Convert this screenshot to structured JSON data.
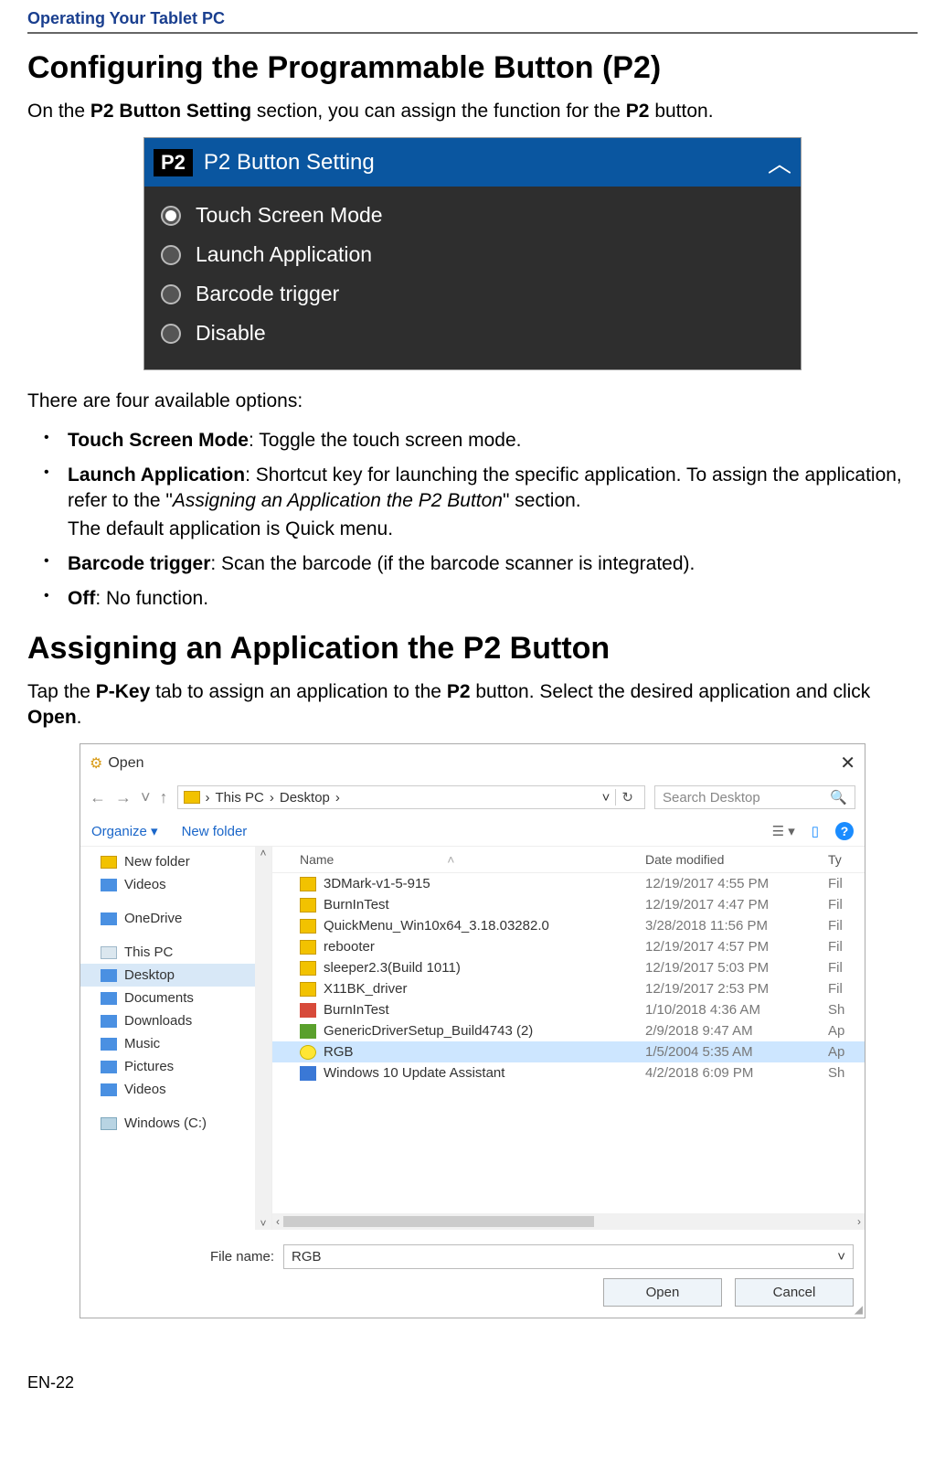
{
  "header": "Operating Your Tablet PC",
  "h1": "Configuring the Programmable Button (P2)",
  "p1_a": "On the ",
  "p1_b": "P2 Button Setting",
  "p1_c": " section, you can assign the function for the ",
  "p1_d": "P2",
  "p1_e": " button.",
  "panel": {
    "badge": "P2",
    "title": "P2 Button Setting",
    "options": [
      "Touch Screen Mode",
      "Launch Application",
      "Barcode trigger",
      "Disable"
    ],
    "selected": 0
  },
  "intro_list": "There are four available options:",
  "opts": {
    "o1_b": "Touch Screen Mode",
    "o1_t": ": Toggle the touch screen mode.",
    "o2_b": "Launch Application",
    "o2_t1": ": Shortcut key for launching the specific application. To assign the application, refer to the \"",
    "o2_i": "Assigning an Application the P2 Button",
    "o2_t2": "\" section.",
    "o2_sub": "The default application is Quick menu.",
    "o3_b": "Barcode trigger",
    "o3_t": ": Scan the barcode (if the barcode scanner is integrated).",
    "o4_b": "Off",
    "o4_t": ": No function."
  },
  "h2": "Assigning an Application the P2 Button",
  "p2_a": "Tap the ",
  "p2_b": "P-Key",
  "p2_c": " tab to assign an application to the ",
  "p2_d": "P2",
  "p2_e": " button. Select the desired application and click ",
  "p2_f": "Open",
  "p2_g": ".",
  "dlg": {
    "title": "Open",
    "crumb1": "This PC",
    "crumb2": "Desktop",
    "search_ph": "Search Desktop",
    "organize": "Organize",
    "newfolder": "New folder",
    "tree": [
      {
        "label": "New folder",
        "ico": "folder"
      },
      {
        "label": "Videos",
        "ico": "blue"
      },
      {
        "label": "OneDrive",
        "ico": "blue"
      },
      {
        "label": "This PC",
        "ico": "pc"
      },
      {
        "label": "Desktop",
        "ico": "blue",
        "sel": true
      },
      {
        "label": "Documents",
        "ico": "blue"
      },
      {
        "label": "Downloads",
        "ico": "blue"
      },
      {
        "label": "Music",
        "ico": "blue"
      },
      {
        "label": "Pictures",
        "ico": "blue"
      },
      {
        "label": "Videos",
        "ico": "blue"
      },
      {
        "label": "Windows (C:)",
        "ico": "drive"
      }
    ],
    "cols": {
      "name": "Name",
      "date": "Date modified",
      "type": "Ty"
    },
    "rows": [
      {
        "name": "3DMark-v1-5-915",
        "date": "12/19/2017 4:55 PM",
        "type": "Fil",
        "ico": "folder"
      },
      {
        "name": "BurnInTest",
        "date": "12/19/2017 4:47 PM",
        "type": "Fil",
        "ico": "folder"
      },
      {
        "name": "QuickMenu_Win10x64_3.18.03282.0",
        "date": "3/28/2018 11:56 PM",
        "type": "Fil",
        "ico": "folder"
      },
      {
        "name": "rebooter",
        "date": "12/19/2017 4:57 PM",
        "type": "Fil",
        "ico": "folder"
      },
      {
        "name": "sleeper2.3(Build 1011)",
        "date": "12/19/2017 5:03 PM",
        "type": "Fil",
        "ico": "folder"
      },
      {
        "name": "X11BK_driver",
        "date": "12/19/2017 2:53 PM",
        "type": "Fil",
        "ico": "folder"
      },
      {
        "name": "BurnInTest",
        "date": "1/10/2018 4:36 AM",
        "type": "Sh",
        "ico": "red"
      },
      {
        "name": "GenericDriverSetup_Build4743 (2)",
        "date": "2/9/2018 9:47 AM",
        "type": "Ap",
        "ico": "grn"
      },
      {
        "name": "RGB",
        "date": "1/5/2004 5:35 AM",
        "type": "Ap",
        "ico": "yel",
        "sel": true
      },
      {
        "name": "Windows 10 Update Assistant",
        "date": "4/2/2018 6:09 PM",
        "type": "Sh",
        "ico": "flag"
      }
    ],
    "file_label": "File name:",
    "file_value": "RGB",
    "open": "Open",
    "cancel": "Cancel"
  },
  "page_num": "EN-22"
}
